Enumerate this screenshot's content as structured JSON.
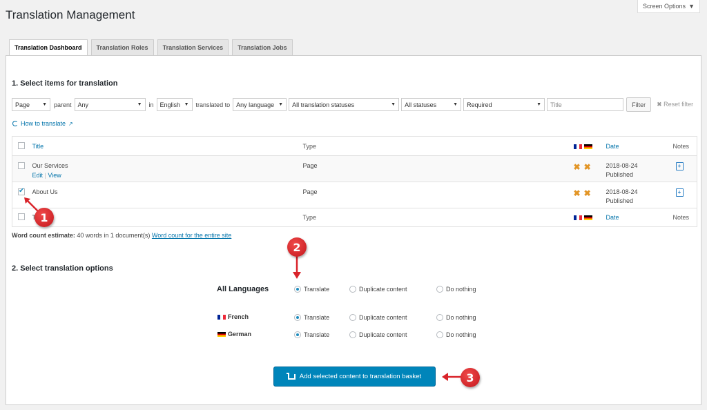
{
  "page_title": "Translation Management",
  "screen_options": "Screen Options",
  "tabs": [
    {
      "label": "Translation Dashboard",
      "active": true
    },
    {
      "label": "Translation Roles"
    },
    {
      "label": "Translation Services"
    },
    {
      "label": "Translation Jobs"
    }
  ],
  "section1": {
    "title": "1. Select items for translation",
    "filters": {
      "type": "Page",
      "parent_label": "parent",
      "parent": "Any",
      "in_label": "in",
      "language_from": "English",
      "translated_to_label": "translated to",
      "language_to": "Any language",
      "translation_status": "All translation statuses",
      "post_status": "All statuses",
      "priority": "Required",
      "title_placeholder": "Title",
      "filter_button": "Filter",
      "reset_filter": "✖ Reset filter"
    },
    "how_to": "How to translate",
    "table": {
      "headers": {
        "title": "Title",
        "type": "Type",
        "date": "Date",
        "notes": "Notes"
      },
      "rows": [
        {
          "title": "Our Services",
          "actions": {
            "edit": "Edit",
            "sep": "|",
            "view": "View"
          },
          "type": "Page",
          "date": "2018-08-24",
          "status": "Published",
          "checked": false
        },
        {
          "title": "About Us",
          "type": "Page",
          "date": "2018-08-24",
          "status": "Published",
          "checked": true
        }
      ]
    },
    "word_count": {
      "label": "Word count estimate:",
      "text": " 40 words in 1 document(s) ",
      "link": "Word count for the entire site"
    }
  },
  "section2": {
    "title": "2. Select translation options",
    "all_languages": "All Languages",
    "options": {
      "translate": "Translate",
      "duplicate": "Duplicate content",
      "nothing": "Do nothing"
    },
    "languages": [
      {
        "name": "French",
        "flag": "fr-flag-icon"
      },
      {
        "name": "German",
        "flag": "de-flag-icon"
      }
    ]
  },
  "submit_button": "Add selected content to translation basket",
  "callouts": [
    "1",
    "2",
    "3"
  ],
  "colors": {
    "accent": "#0085ba",
    "link": "#0073aa",
    "callout": "#d9232a",
    "status_x": "#e29526"
  }
}
